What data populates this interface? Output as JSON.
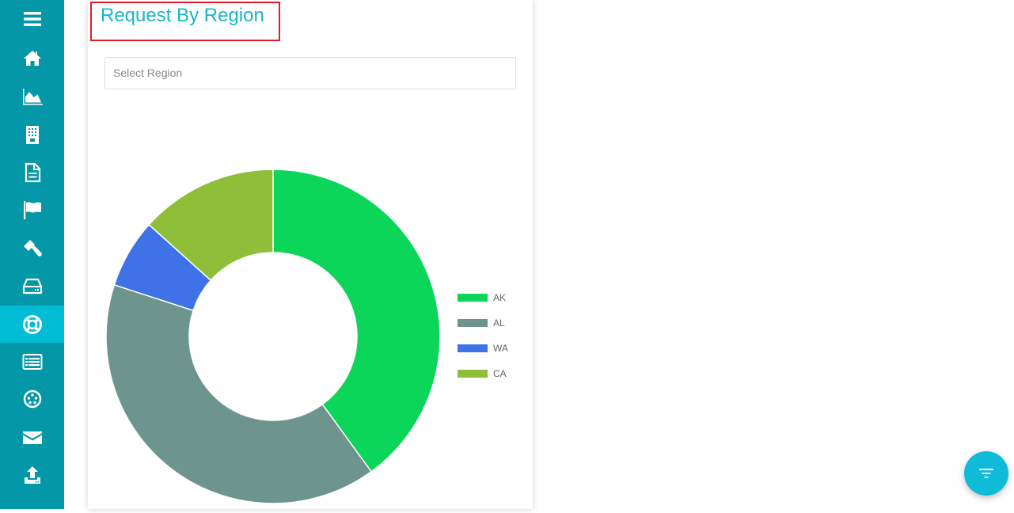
{
  "sidebar": {
    "items": [
      {
        "icon": "menu-icon",
        "active": false
      },
      {
        "icon": "home-icon",
        "active": false
      },
      {
        "icon": "area-chart-icon",
        "active": false
      },
      {
        "icon": "building-icon",
        "active": false
      },
      {
        "icon": "document-icon",
        "active": false
      },
      {
        "icon": "flag-icon",
        "active": false
      },
      {
        "icon": "gavel-icon",
        "active": false
      },
      {
        "icon": "hard-drive-icon",
        "active": false
      },
      {
        "icon": "life-ring-icon",
        "active": true
      },
      {
        "icon": "list-icon",
        "active": false
      },
      {
        "icon": "network-icon",
        "active": false
      },
      {
        "icon": "mail-icon",
        "active": false
      },
      {
        "icon": "upload-icon",
        "active": false
      }
    ],
    "colors": {
      "background": "#0397a7",
      "active": "#00bcd4"
    }
  },
  "card": {
    "title": "Request By Region",
    "select": {
      "placeholder": "Select Region"
    }
  },
  "fab": {
    "icon": "filter-icon",
    "color": "#0fbbd8"
  },
  "chart_data": {
    "type": "pie",
    "variant": "doughnut",
    "title": "Request By Region",
    "categories": [
      "AK",
      "AL",
      "WA",
      "CA"
    ],
    "values": [
      6,
      6,
      1,
      2
    ],
    "percentages": [
      40,
      40,
      6.7,
      13.3
    ],
    "colors": [
      "#0cd65a",
      "#6d958d",
      "#3e72e6",
      "#8fbe38"
    ],
    "legend": {
      "entries": [
        "AK",
        "AL",
        "WA",
        "CA"
      ],
      "placement": "right"
    }
  }
}
